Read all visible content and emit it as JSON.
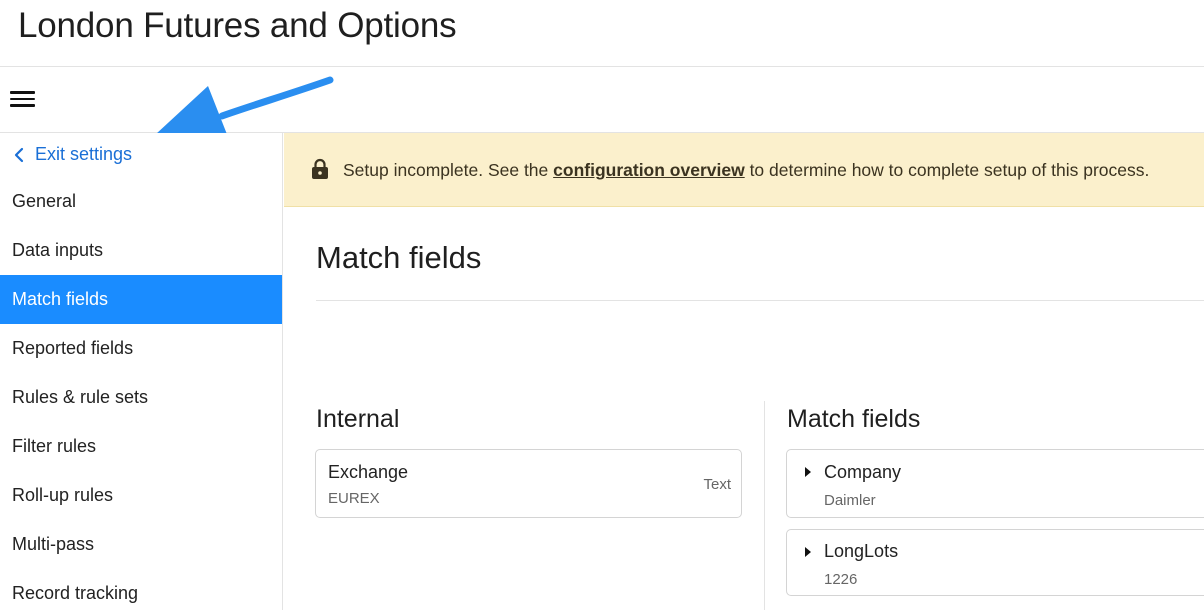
{
  "app": {
    "title": "London Futures and Options"
  },
  "sidebar": {
    "exit_label": "Exit settings",
    "items": [
      {
        "label": "General",
        "active": false
      },
      {
        "label": "Data inputs",
        "active": false
      },
      {
        "label": "Match fields",
        "active": true
      },
      {
        "label": "Reported fields",
        "active": false
      },
      {
        "label": "Rules & rule sets",
        "active": false
      },
      {
        "label": "Filter rules",
        "active": false
      },
      {
        "label": "Roll-up rules",
        "active": false
      },
      {
        "label": "Multi-pass",
        "active": false
      },
      {
        "label": "Record tracking",
        "active": false
      }
    ]
  },
  "banner": {
    "text_before": "Setup incomplete. See the ",
    "link_text": "configuration overview",
    "text_after": " to determine how to complete setup of this process."
  },
  "page": {
    "title": "Match fields"
  },
  "internal": {
    "heading": "Internal",
    "fields": [
      {
        "name": "Exchange",
        "value": "EUREX",
        "type": "Text"
      }
    ]
  },
  "match_fields": {
    "heading": "Match fields",
    "fields": [
      {
        "name": "Company",
        "value": "Daimler"
      },
      {
        "name": "LongLots",
        "value": "1226"
      }
    ]
  },
  "colors": {
    "accent": "#1a8cff",
    "link": "#1a6fd6",
    "banner_bg": "#fbf0cc",
    "annotation_arrow": "#2a8ef0"
  }
}
